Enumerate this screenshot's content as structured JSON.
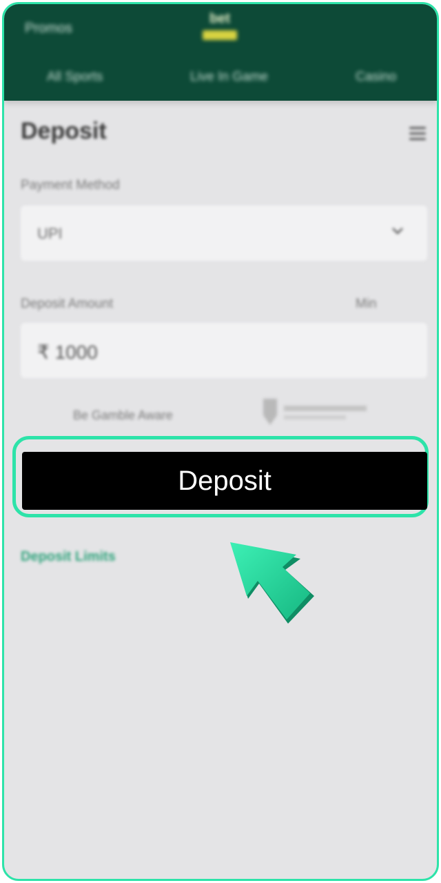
{
  "header": {
    "left_link": "Promos",
    "logo_text": "bet",
    "tabs": [
      "All Sports",
      "Live In Game",
      "Casino"
    ]
  },
  "page": {
    "title": "Deposit"
  },
  "payment": {
    "label": "Payment Method",
    "selected": "UPI"
  },
  "amount": {
    "label": "Deposit Amount",
    "min_label": "Min",
    "value": "₹ 1000"
  },
  "info": {
    "text": "Be Gamble Aware"
  },
  "actions": {
    "deposit_label": "Deposit",
    "limits_link": "Deposit Limits"
  },
  "colors": {
    "header_bg": "#0d4a37",
    "accent": "#2de3a9",
    "button_bg": "#000000",
    "link": "#2ea37b"
  }
}
